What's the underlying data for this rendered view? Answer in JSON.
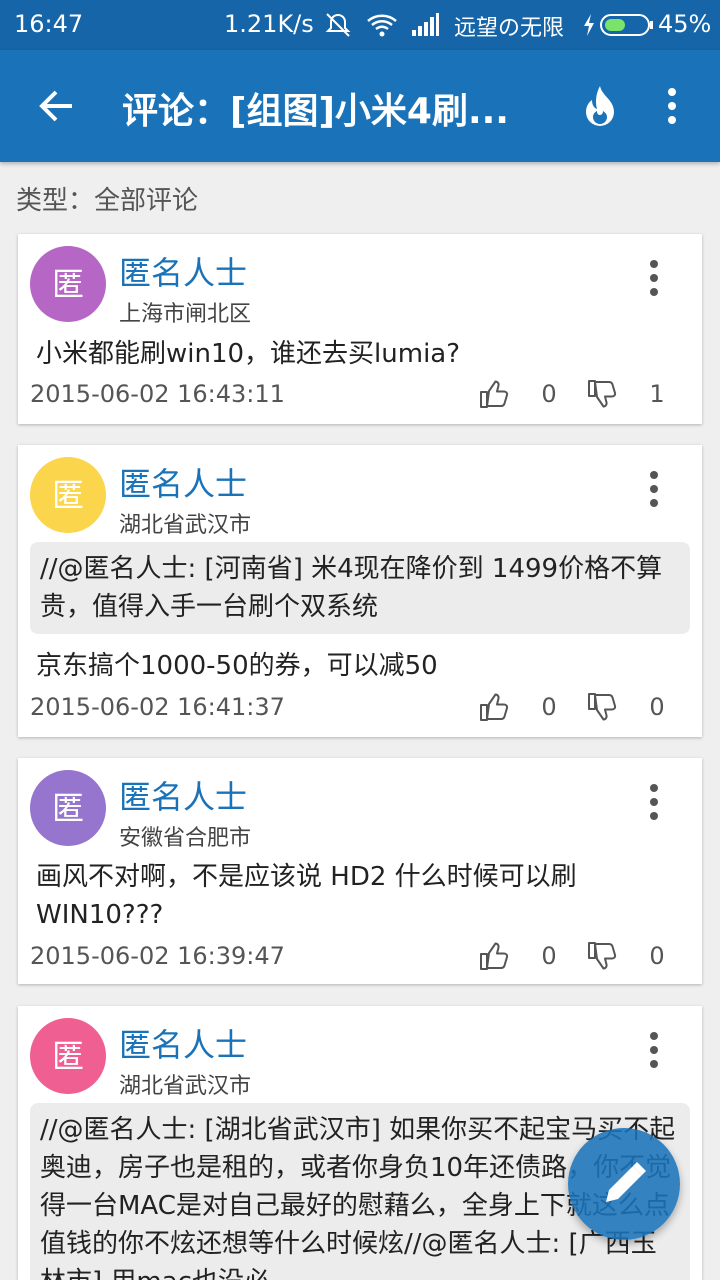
{
  "status_bar": {
    "time": "16:47",
    "net_speed": "1.21K/s",
    "carrier": "远望の无限",
    "battery": "45%"
  },
  "toolbar": {
    "title": "评论：[组图]小米4刷..."
  },
  "filter": {
    "label": "类型：全部评论"
  },
  "comments": [
    {
      "avatar_char": "匿",
      "avatar_color": "#b667c6",
      "name": "匿名人士",
      "location": "上海市闸北区",
      "quote": "",
      "text": "小米都能刷win10，谁还去买lumia?",
      "time": "2015-06-02 16:43:11",
      "likes": "0",
      "dislikes": "1"
    },
    {
      "avatar_char": "匿",
      "avatar_color": "#fbd54b",
      "name": "匿名人士",
      "location": "湖北省武汉市",
      "quote": "//@匿名人士: [河南省] 米4现在降价到 1499价格不算贵，值得入手一台刷个双系统",
      "text": "京东搞个1000-50的券，可以减50",
      "time": "2015-06-02 16:41:37",
      "likes": "0",
      "dislikes": "0"
    },
    {
      "avatar_char": "匿",
      "avatar_color": "#9575cd",
      "name": "匿名人士",
      "location": "安徽省合肥市",
      "quote": "",
      "text": "画风不对啊，不是应该说 HD2 什么时候可以刷WIN10???",
      "time": "2015-06-02 16:39:47",
      "likes": "0",
      "dislikes": "0"
    },
    {
      "avatar_char": "匿",
      "avatar_color": "#ef5f91",
      "name": "匿名人士",
      "location": "湖北省武汉市",
      "quote": "//@匿名人士: [湖北省武汉市] 如果你买不起宝马买不起奥迪，房子也是租的，或者你身负10年还债路，你不觉得一台MAC是对自己最好的慰藉么，全身上下就这么点值钱的你不炫还想等什么时候炫//@匿名人士: [广西玉林市] 用mac也没必"
    }
  ],
  "colors": {
    "primary": "#1a73b8",
    "status_bar": "#1565a8"
  }
}
